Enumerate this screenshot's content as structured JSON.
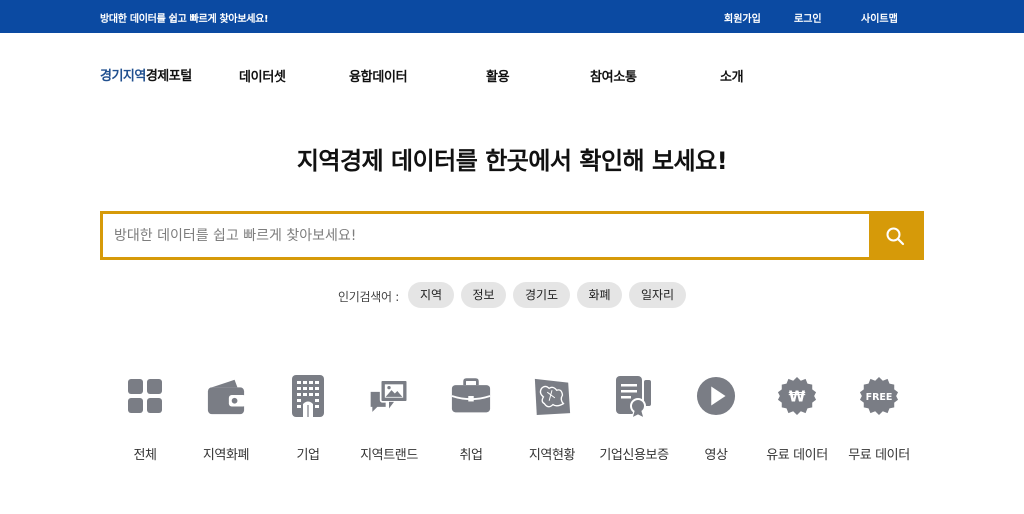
{
  "topbar": {
    "slogan": "방대한 데이터를 쉽고 빠르게 찾아보세요!",
    "links": [
      "회원가입",
      "로그인",
      "사이트맵"
    ]
  },
  "logo": {
    "part1": "경기지역",
    "part2": "경제포털"
  },
  "nav": [
    "데이터셋",
    "융합데이터",
    "활용",
    "참여소통",
    "소개"
  ],
  "headline": "지역경제 데이터를 한곳에서 확인해 보세요!",
  "search": {
    "placeholder": "방대한 데이터를 쉽고 빠르게 찾아보세요!",
    "value": ""
  },
  "popular": {
    "label": "인기검색어 :",
    "keywords": [
      "지역",
      "정보",
      "경기도",
      "화폐",
      "일자리"
    ]
  },
  "categories": [
    {
      "label": "전체",
      "icon": "grid-icon"
    },
    {
      "label": "지역화폐",
      "icon": "wallet-icon"
    },
    {
      "label": "기업",
      "icon": "building-icon"
    },
    {
      "label": "지역트랜드",
      "icon": "image-chat-icon"
    },
    {
      "label": "취업",
      "icon": "briefcase-icon"
    },
    {
      "label": "지역현황",
      "icon": "map-icon"
    },
    {
      "label": "기업신용보증",
      "icon": "certificate-icon"
    },
    {
      "label": "영상",
      "icon": "play-icon"
    },
    {
      "label": "유료 데이터",
      "icon": "won-badge-icon",
      "badge_text": "₩"
    },
    {
      "label": "무료 데이터",
      "icon": "free-badge-icon",
      "badge_text": "FREE"
    }
  ],
  "colors": {
    "topbar": "#0b4aa2",
    "accent": "#d69a09",
    "icon": "#7a7d85",
    "chip": "#e5e5e5"
  }
}
